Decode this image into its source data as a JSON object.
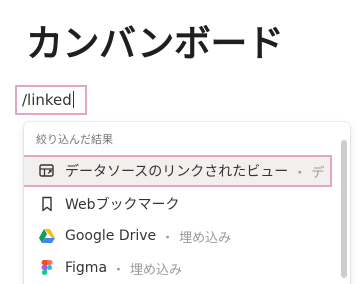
{
  "page": {
    "title": "カンバンボード"
  },
  "command_input": {
    "value": "/linked"
  },
  "menu": {
    "header": "絞り込んだ結果",
    "items": [
      {
        "icon": "linked-database-icon",
        "label": "データソースのリンクされたビュー",
        "sep": "・",
        "desc": "デ",
        "selected": true
      },
      {
        "icon": "bookmark-icon",
        "label": "Webブックマーク",
        "sep": "",
        "desc": "",
        "selected": false
      },
      {
        "icon": "google-drive-icon",
        "label": "Google Drive",
        "sep": "・",
        "desc": "埋め込み",
        "selected": false
      },
      {
        "icon": "figma-icon",
        "label": "Figma",
        "sep": "・",
        "desc": "埋め込み",
        "selected": false
      }
    ]
  },
  "colors": {
    "highlight_border": "#e3a6c6",
    "selected_bg": "#f1f0ef",
    "muted_text": "#9b9a97"
  }
}
